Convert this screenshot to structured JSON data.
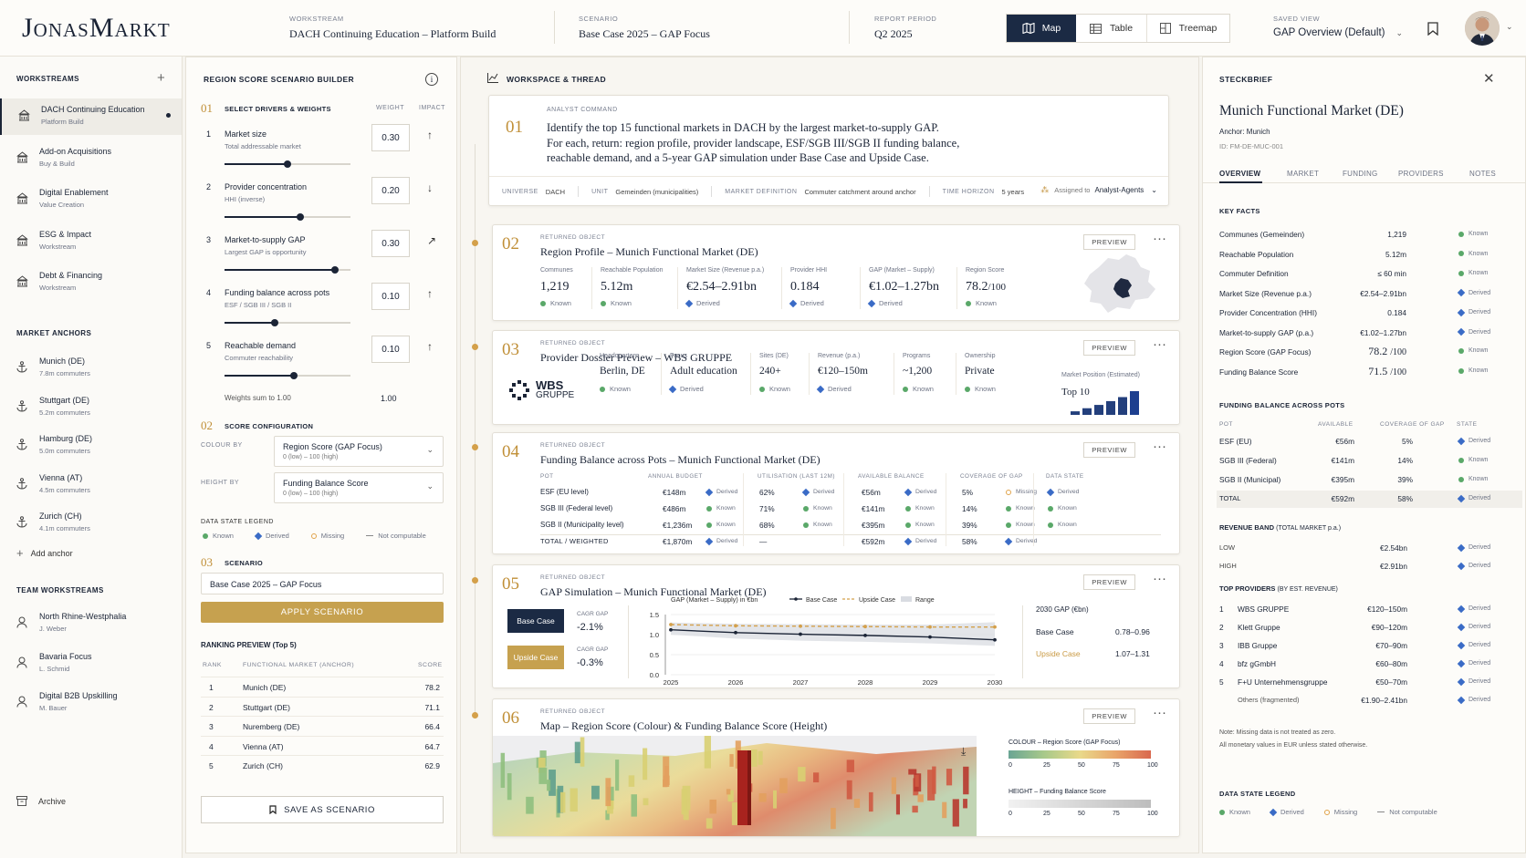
{
  "header": {
    "brand": "JonasMarkt",
    "workstream": {
      "label": "WORKSTREAM",
      "value": "DACH Continuing Education – Platform Build"
    },
    "scenario": {
      "label": "SCENARIO",
      "value": "Base Case 2025 – GAP Focus"
    },
    "period": {
      "label": "REPORT PERIOD",
      "value": "Q2 2025"
    },
    "views": [
      {
        "label": "Map",
        "active": true
      },
      {
        "label": "Table"
      },
      {
        "label": "Treemap"
      }
    ],
    "saved_view": {
      "label": "SAVED VIEW",
      "value": "GAP Overview (Default)"
    }
  },
  "sidebar": {
    "workstreams_title": "WORKSTREAMS",
    "workstreams": [
      {
        "title": "DACH Continuing Education",
        "sub": "Platform Build"
      },
      {
        "title": "Add-on Acquisitions",
        "sub": "Buy & Build"
      },
      {
        "title": "Digital Enablement",
        "sub": "Value Creation"
      },
      {
        "title": "ESG & Impact",
        "sub": "Workstream"
      },
      {
        "title": "Debt & Financing",
        "sub": "Workstream"
      }
    ],
    "anchors_title": "MARKET ANCHORS",
    "anchors": [
      {
        "title": "Munich (DE)",
        "sub": "7.8m commuters"
      },
      {
        "title": "Stuttgart (DE)",
        "sub": "5.2m commuters"
      },
      {
        "title": "Hamburg (DE)",
        "sub": "5.0m commuters"
      },
      {
        "title": "Vienna (AT)",
        "sub": "4.5m commuters"
      },
      {
        "title": "Zurich (CH)",
        "sub": "4.1m commuters"
      }
    ],
    "add_anchor": "Add anchor",
    "team_title": "TEAM WORKSTREAMS",
    "team": [
      {
        "title": "North Rhine-Westphalia",
        "sub": "J. Weber"
      },
      {
        "title": "Bavaria Focus",
        "sub": "L. Schmid"
      },
      {
        "title": "Digital B2B Upskilling",
        "sub": "M. Bauer"
      }
    ],
    "archive": "Archive"
  },
  "builder": {
    "title": "REGION SCORE SCENARIO BUILDER",
    "s1_num": "01",
    "s1_title": "SELECT DRIVERS & WEIGHTS",
    "weight_col": "WEIGHT",
    "impact_col": "IMPACT",
    "drivers": [
      {
        "n": "1",
        "title": "Market size",
        "sub": "Total addressable market",
        "weight": "0.30",
        "impact": "↑",
        "pos": 0.5
      },
      {
        "n": "2",
        "title": "Provider concentration",
        "sub": "HHI (inverse)",
        "weight": "0.20",
        "impact": "↓",
        "pos": 0.6
      },
      {
        "n": "3",
        "title": "Market-to-supply GAP",
        "sub": "Largest GAP is opportunity",
        "weight": "0.30",
        "impact": "↗",
        "pos": 0.88
      },
      {
        "n": "4",
        "title": "Funding balance across pots",
        "sub": "ESF / SGB III / SGB II",
        "weight": "0.10",
        "impact": "↑",
        "pos": 0.4
      },
      {
        "n": "5",
        "title": "Reachable demand",
        "sub": "Commuter reachability",
        "weight": "0.10",
        "impact": "↑",
        "pos": 0.55
      }
    ],
    "weights_sum_label": "Weights sum to 1.00",
    "weights_sum": "1.00",
    "s2_num": "02",
    "s2_title": "SCORE CONFIGURATION",
    "colour_by_label": "COLOUR BY",
    "colour_by": "Region Score (GAP Focus)",
    "colour_by_sub": "0 (low) – 100 (high)",
    "height_by_label": "HEIGHT BY",
    "height_by": "Funding Balance Score",
    "height_by_sub": "0 (low) – 100 (high)",
    "legend_title": "DATA STATE LEGEND",
    "legend": [
      "Known",
      "Derived",
      "Missing",
      "Not computable"
    ],
    "s3_num": "03",
    "s3_title": "SCENARIO",
    "scenario_value": "Base Case 2025 – GAP Focus",
    "apply": "APPLY SCENARIO",
    "ranking_title": "RANKING PREVIEW (Top 5)",
    "ranking_cols": [
      "RANK",
      "FUNCTIONAL MARKET (ANCHOR)",
      "SCORE"
    ],
    "ranking": [
      [
        "1",
        "Munich (DE)",
        "78.2"
      ],
      [
        "2",
        "Stuttgart (DE)",
        "71.1"
      ],
      [
        "3",
        "Nuremberg (DE)",
        "66.4"
      ],
      [
        "4",
        "Vienna (AT)",
        "64.7"
      ],
      [
        "5",
        "Zurich (CH)",
        "62.9"
      ]
    ],
    "save": "SAVE AS SCENARIO"
  },
  "workspace": {
    "title": "WORKSPACE & THREAD",
    "cmd": {
      "num": "01",
      "label": "ANALYST COMMAND",
      "line1": "Identify the top 15 functional markets in DACH by the largest market-to-supply GAP.",
      "line2": "For each, return: region profile, provider landscape, ESF/SGB III/SGB II funding balance,",
      "line3": "reachable demand, and a 5-year GAP simulation under Base Case and Upside Case.",
      "meta": [
        [
          "UNIVERSE",
          "DACH"
        ],
        [
          "UNIT",
          "Gemeinden (municipalities)"
        ],
        [
          "MARKET DEFINITION",
          "Commuter catchment around anchor"
        ],
        [
          "TIME HORIZON",
          "5 years"
        ]
      ],
      "assigned_label": "Assigned to",
      "assigned": "Analyst-Agents"
    },
    "returned": "RETURNED OBJECT",
    "preview": "PREVIEW",
    "c2": {
      "num": "02",
      "title": "Region Profile – Munich Functional Market (DE)",
      "kpis": [
        {
          "l": "Communes",
          "v": "1,219",
          "s": "Known"
        },
        {
          "l": "Reachable Population",
          "v": "5.12m",
          "s": "Known"
        },
        {
          "l": "Market Size (Revenue p.a.)",
          "v": "€2.54–2.91bn",
          "s": "Derived"
        },
        {
          "l": "Provider HHI",
          "v": "0.184",
          "s": "Derived"
        },
        {
          "l": "GAP (Market – Supply)",
          "v": "€1.02–1.27bn",
          "s": "Derived"
        },
        {
          "l": "Region Score",
          "v": "78.2",
          "v2": "/100",
          "s": "Known"
        }
      ]
    },
    "c3": {
      "num": "03",
      "title": "Provider Dossier Preview – WBS GRUPPE",
      "logo1": "WBS",
      "logo2": "GRUPPE",
      "kpis": [
        {
          "l": "Headquarters",
          "v": "Berlin, DE",
          "s": "Known"
        },
        {
          "l": "Focus",
          "v": "Adult education",
          "s": "Derived"
        },
        {
          "l": "Sites (DE)",
          "v": "240+",
          "s": "Known"
        },
        {
          "l": "Revenue (p.a.)",
          "v": "€120–150m",
          "s": "Derived"
        },
        {
          "l": "Programs",
          "v": "~1,200",
          "s": "Known"
        },
        {
          "l": "Ownership",
          "v": "Private",
          "s": "Known"
        }
      ],
      "pos_label": "Market Position (Estimated)",
      "pos_value": "Top 10",
      "bars": [
        0.15,
        0.28,
        0.42,
        0.58,
        0.75,
        1.0
      ]
    },
    "c4": {
      "num": "04",
      "title": "Funding Balance across Pots – Munich Functional Market (DE)",
      "cols": [
        "POT",
        "ANNUAL BUDGET",
        "UTILISATION (last 12m)",
        "AVAILABLE BALANCE",
        "COVERAGE OF GAP",
        "DATA STATE"
      ],
      "rows": [
        {
          "pot": "ESF (EU level)",
          "budget": "€148m",
          "bs": "Derived",
          "util": "62%",
          "us": "Derived",
          "avail": "€56m",
          "as": "Derived",
          "cov": "5%",
          "cs": "Missing",
          "ds": "Derived"
        },
        {
          "pot": "SGB III (Federal level)",
          "budget": "€486m",
          "bs": "Known",
          "util": "71%",
          "us": "Known",
          "avail": "€141m",
          "as": "Known",
          "cov": "14%",
          "cs": "Known",
          "ds": "Known"
        },
        {
          "pot": "SGB II (Municipality level)",
          "budget": "€1,236m",
          "bs": "Known",
          "util": "68%",
          "us": "Known",
          "avail": "€395m",
          "as": "Known",
          "cov": "39%",
          "cs": "Known",
          "ds": "Known"
        },
        {
          "pot": "TOTAL / WEIGHTED",
          "budget": "€1,870m",
          "bs": "Derived",
          "util": "—",
          "us": "",
          "avail": "€592m",
          "as": "Derived",
          "cov": "58%",
          "cs": "Derived",
          "ds": ""
        }
      ]
    },
    "c5": {
      "num": "05",
      "title": "GAP Simulation – Munich Functional Market (DE)",
      "base_btn": "Base Case",
      "upside_btn": "Upside Case",
      "cagr_label": "CAGR GAP",
      "base_cagr": "-2.1%",
      "upside_cagr": "-0.3%",
      "right_title": "2030 GAP (€bn)",
      "base_label": "Base Case",
      "base_range": "0.78–0.96",
      "upside_label": "Upside Case",
      "upside_range": "1.07–1.31"
    },
    "c6": {
      "num": "06",
      "title": "Map – Region Score (Colour) & Funding Balance Score (Height)",
      "colour_title": "COLOUR – Region Score (GAP Focus)",
      "height_title": "HEIGHT – Funding Balance Score",
      "ticks": [
        "0",
        "25",
        "50",
        "75",
        "100"
      ]
    }
  },
  "chart_data": {
    "type": "line",
    "title": "GAP (Market – Supply) in €bn",
    "x": [
      2025,
      2026,
      2027,
      2028,
      2029,
      2030
    ],
    "series": [
      {
        "name": "Base Case",
        "values": [
          1.12,
          1.05,
          1.01,
          0.98,
          0.94,
          0.87
        ]
      },
      {
        "name": "Upside Case",
        "values": [
          1.25,
          1.22,
          1.21,
          1.2,
          1.19,
          1.19
        ]
      },
      {
        "name": "Range"
      }
    ],
    "ylim": [
      0,
      1.5
    ],
    "yticks": [
      "1.5",
      "1.0",
      "0.5",
      "0.0"
    ],
    "range_low": [
      1.0,
      0.9,
      0.85,
      0.82,
      0.78,
      0.72
    ],
    "range_high": [
      1.3,
      1.27,
      1.26,
      1.25,
      1.25,
      1.31
    ],
    "legend": "top",
    "colors": {
      "base": "#1b2436",
      "upside": "#d4a04a",
      "range": "#d9dce2"
    }
  },
  "steckbrief": {
    "title": "STECKBRIEF",
    "name": "Munich Functional Market (DE)",
    "anchor": "Anchor: Munich",
    "id": "ID: FM-DE-MUC-001",
    "tabs": [
      "OVERVIEW",
      "MARKET",
      "FUNDING",
      "PROVIDERS",
      "NOTES"
    ],
    "facts_title": "KEY FACTS",
    "facts": [
      [
        "Communes (Gemeinden)",
        "1,219",
        "Known"
      ],
      [
        "Reachable Population",
        "5.12m",
        "Known"
      ],
      [
        "Commuter Definition",
        "≤ 60 min",
        "Known"
      ],
      [
        "Market Size (Revenue p.a.)",
        "€2.54–2.91bn",
        "Derived"
      ],
      [
        "Provider Concentration (HHI)",
        "0.184",
        "Derived"
      ],
      [
        "Market-to-supply GAP (p.a.)",
        "€1.02–1.27bn",
        "Derived"
      ]
    ],
    "score_rows": [
      [
        "Region Score (GAP Focus)",
        "78.2",
        "/100",
        "Known"
      ],
      [
        "Funding Balance Score",
        "71.5",
        "/100",
        "Known"
      ]
    ],
    "fb_title": "FUNDING BALANCE ACROSS POTS",
    "fb_cols": [
      "POT",
      "AVAILABLE",
      "COVERAGE OF GAP",
      "STATE"
    ],
    "fb_rows": [
      [
        "ESF (EU)",
        "€56m",
        "5%",
        "Derived"
      ],
      [
        "SGB III (Federal)",
        "€141m",
        "14%",
        "Known"
      ],
      [
        "SGB II (Municipal)",
        "€395m",
        "39%",
        "Known"
      ],
      [
        "TOTAL",
        "€592m",
        "58%",
        "Derived"
      ]
    ],
    "rb_title": "REVENUE BAND",
    "rb_sub": "(TOTAL MARKET p.a.)",
    "rb_rows": [
      [
        "LOW",
        "€2.54bn",
        "Derived"
      ],
      [
        "HIGH",
        "€2.91bn",
        "Derived"
      ]
    ],
    "tp_title": "TOP PROVIDERS",
    "tp_sub": "(BY EST. REVENUE)",
    "tp_rows": [
      [
        "1",
        "WBS GRUPPE",
        "€120–150m",
        "Derived"
      ],
      [
        "2",
        "Klett Gruppe",
        "€90–120m",
        "Derived"
      ],
      [
        "3",
        "IBB Gruppe",
        "€70–90m",
        "Derived"
      ],
      [
        "4",
        "bfz gGmbH",
        "€60–80m",
        "Derived"
      ],
      [
        "5",
        "F+U Unternehmensgruppe",
        "€50–70m",
        "Derived"
      ],
      [
        "",
        "Others (fragmented)",
        "€1.90–2.41bn",
        "Derived"
      ]
    ],
    "note1": "Note: Missing data is not treated as zero.",
    "note2": "All monetary values in EUR unless stated otherwise.",
    "legend_title": "DATA STATE LEGEND",
    "legend": [
      "Known",
      "Derived",
      "Missing",
      "Not computable"
    ]
  }
}
